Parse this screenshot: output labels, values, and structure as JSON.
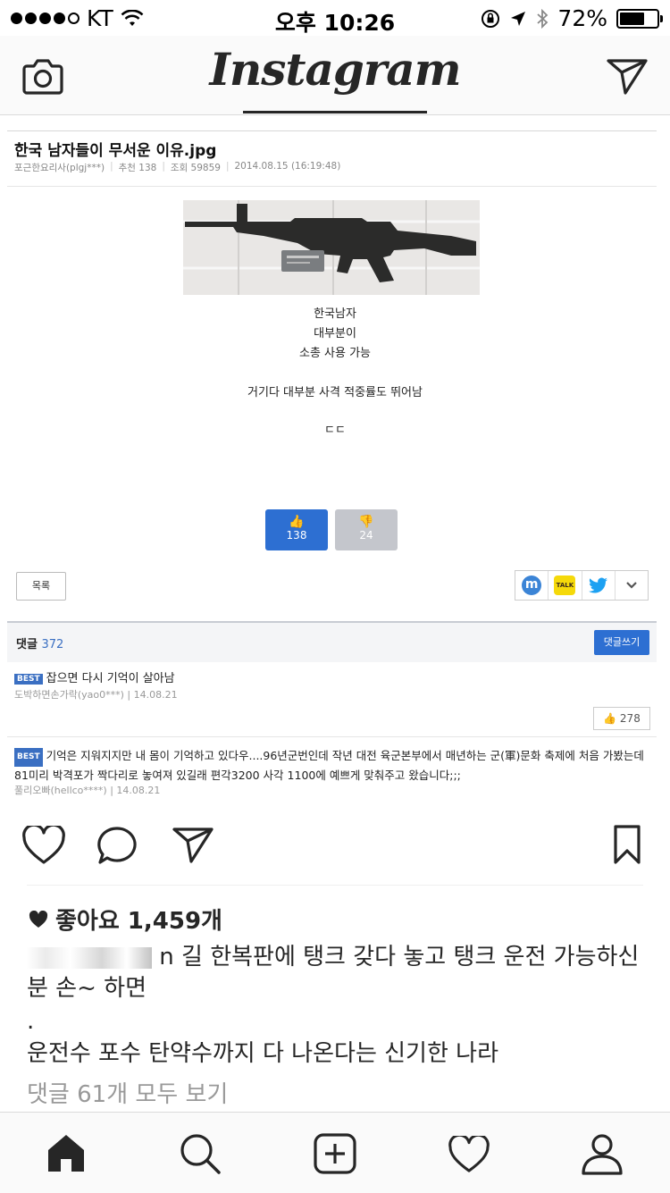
{
  "status_bar": {
    "carrier": "KT",
    "time": "오후 10:26",
    "battery": "72%",
    "battery_level": 0.72
  },
  "header": {
    "logo": "Instagram",
    "camera_icon": "camera-icon",
    "direct_icon": "paper-plane-icon"
  },
  "post_image": {
    "title": "한국 남자들이 무서운 이유.jpg",
    "meta": {
      "author": "포근한요리사(plgj***)",
      "recommend": "추천 138",
      "views": "조회 59859",
      "date": "2014.08.15 (16:19:48)"
    },
    "lines": [
      "한국남자",
      "대부분이",
      "소총 사용 가능"
    ],
    "line4": "거기다 대부분 사격 적중률도 뛰어남",
    "line5": "ㄷㄷ",
    "upvotes": "138",
    "downvotes": "24",
    "list_button": "목록",
    "comments_label": "댓글",
    "comments_count": "372",
    "write_button": "댓글쓰기",
    "best_tag": "BEST",
    "comment1": "잡으면 다시 기억이 살아남",
    "comment1_meta": "도박하면손가락(yao0***)  |  14.08.21",
    "comment1_likes": "278",
    "comment2": "기억은 지워지지만 내 몸이 기억하고 있다우....96년군번인데 작년 대전 육군본부에서 매년하는 군(軍)문화 축제에 처음 가봤는데 81미리 박격포가 짝다리로 놓여져 있길래 편각3200 사각 1100에 예쁘게 맞춰주고 왔습니다;;;",
    "comment2_meta": "풀리오빠(hellco****)  |  14.08.21"
  },
  "actions": {
    "like_icon": "heart-icon",
    "comment_icon": "comment-icon",
    "share_icon": "paper-plane-icon",
    "save_icon": "bookmark-icon"
  },
  "likes": "좋아요 1,459개",
  "caption": {
    "partial": "n 길 한복판에 탱크 갖다 놓고 탱크 운전 가능하신분 손~ 하면",
    "dot": ".",
    "line2": "운전수 포수 탄약수까지 다 나온다는 신기한 나라"
  },
  "view_all_comments": "댓글 61개 모두 보기",
  "tabbar": [
    "home-icon",
    "search-icon",
    "add-icon",
    "activity-heart-icon",
    "profile-icon"
  ],
  "colors": {
    "upvote": "#2d6fd2",
    "downvote": "#c4c6cc",
    "accent_blue": "#3a6fc2"
  }
}
